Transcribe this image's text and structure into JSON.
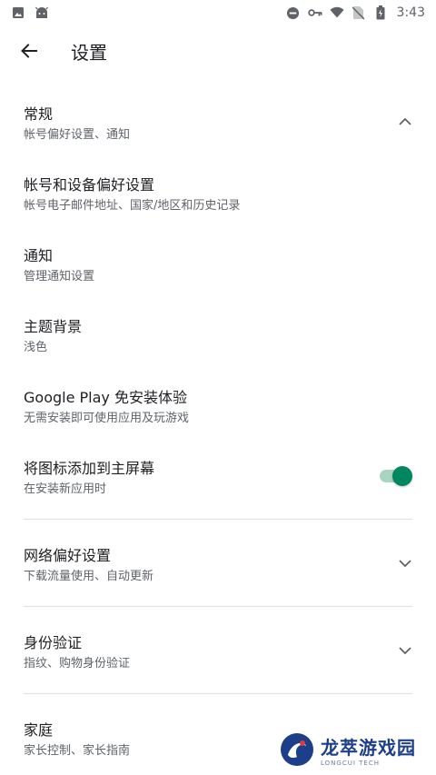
{
  "status_bar": {
    "time": "3:43",
    "icons": [
      "image-icon",
      "android-icon",
      "do-not-disturb-icon",
      "vpn-key-icon",
      "wifi-icon",
      "no-sim-icon",
      "battery-icon"
    ]
  },
  "app_bar": {
    "back_icon": "arrow-back-icon",
    "title": "设置"
  },
  "settings": {
    "general": {
      "title": "常规",
      "subtitle": "帐号偏好设置、通知",
      "icon": "chevron-up-icon"
    },
    "account": {
      "title": "帐号和设备偏好设置",
      "subtitle": "帐号电子邮件地址、国家/地区和历史记录"
    },
    "notifications": {
      "title": "通知",
      "subtitle": "管理通知设置"
    },
    "theme": {
      "title": "主题背景",
      "subtitle": "浅色"
    },
    "instant": {
      "title": "Google Play 免安装体验",
      "subtitle": "无需安装即可使用应用及玩游戏"
    },
    "home_icon": {
      "title": "将图标添加到主屏幕",
      "subtitle": "在安装新应用时",
      "toggle_on": true,
      "accent": "#01875f"
    },
    "network": {
      "title": "网络偏好设置",
      "subtitle": "下载流量使用、自动更新",
      "icon": "chevron-down-icon"
    },
    "auth": {
      "title": "身份验证",
      "subtitle": "指纹、购物身份验证",
      "icon": "chevron-down-icon"
    },
    "family": {
      "title": "家庭",
      "subtitle": "家长控制、家长指南"
    }
  },
  "watermark": {
    "title": "龙萃游戏园",
    "subtitle": "LONGCUI TECH"
  }
}
